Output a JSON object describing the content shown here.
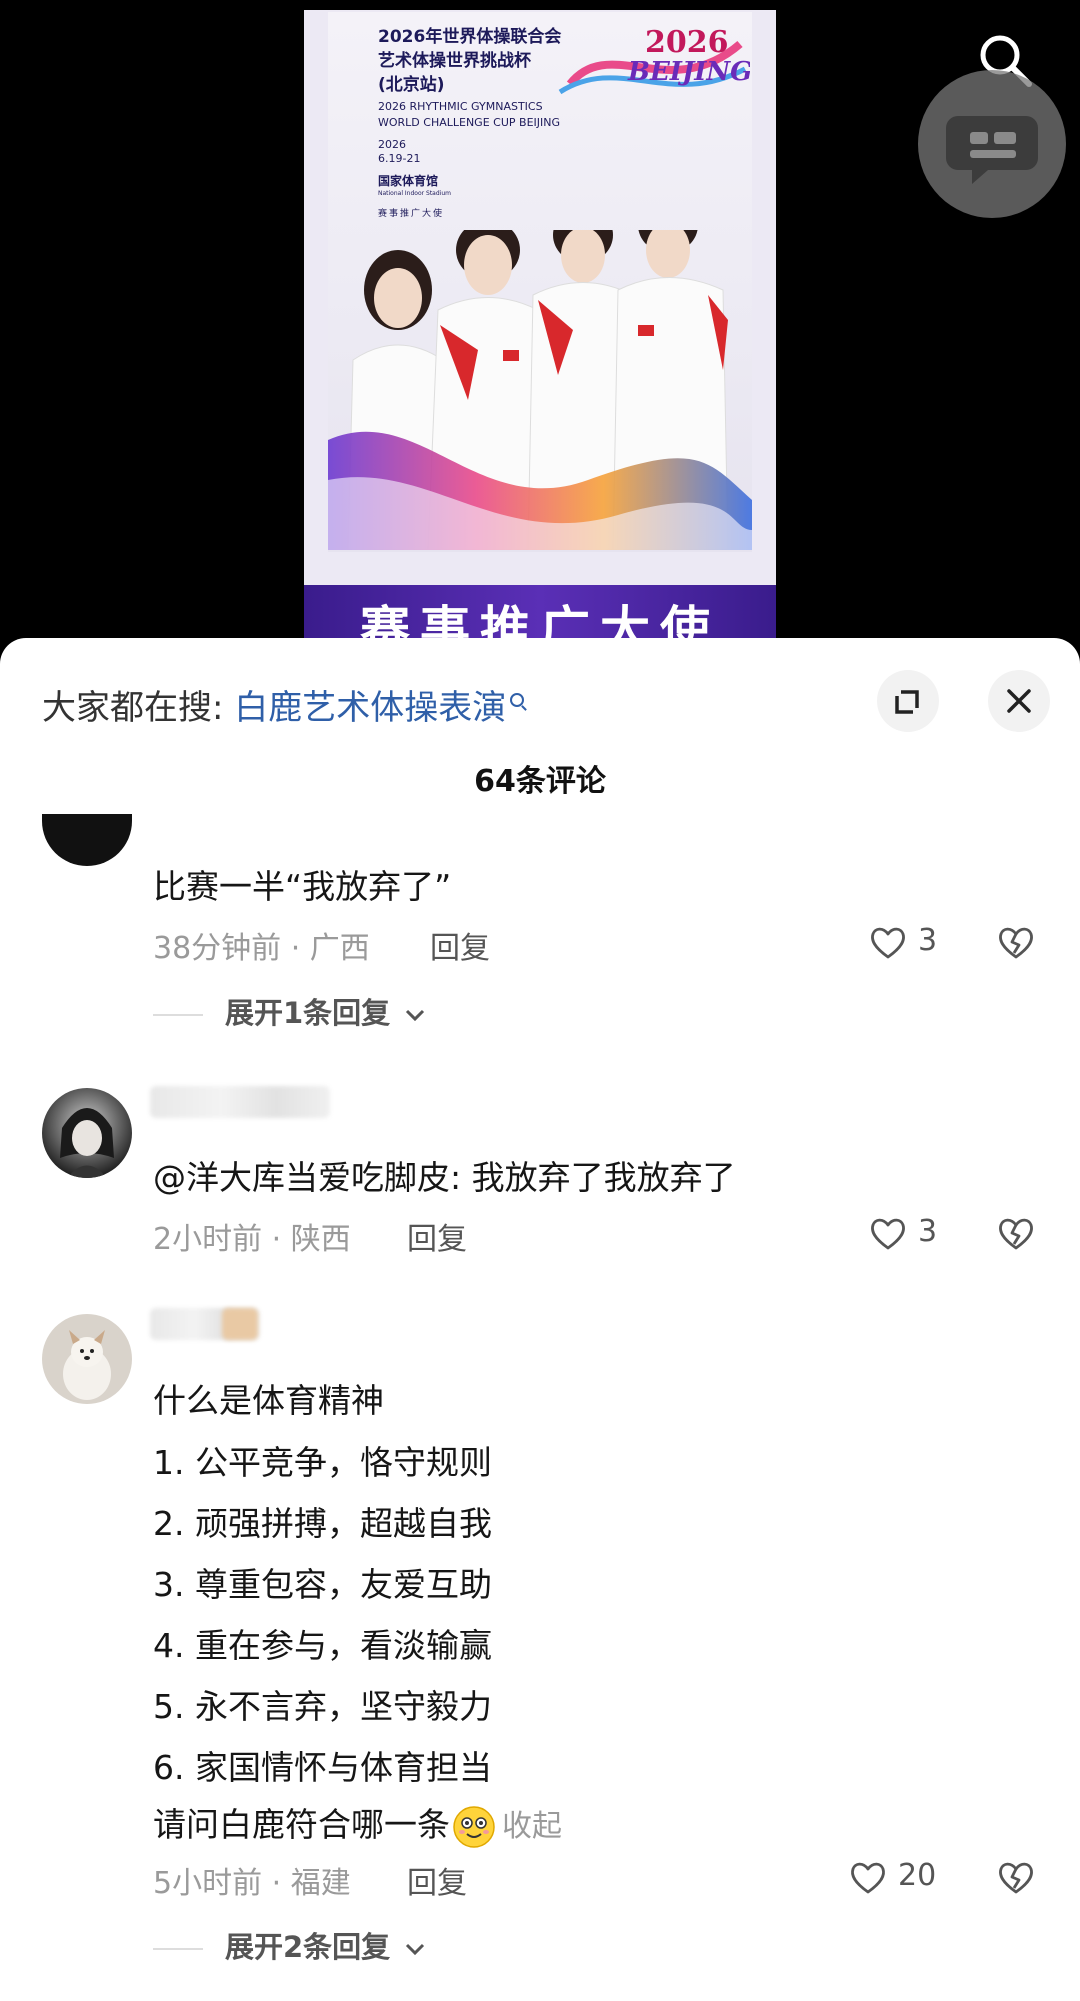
{
  "poster": {
    "title_line1": "2026年世界体操联合会",
    "title_line2": "艺术体操世界挑战杯",
    "title_line3": "(北京站)",
    "subtitle_en_1": "2026 RHYTHMIC GYMNASTICS",
    "subtitle_en_2": "WORLD CHALLENGE CUP BEIJING",
    "year": "2026",
    "dates": "6.19-21",
    "venue": "国家体育馆",
    "venue_en": "National Indoor Stadium",
    "ambassador_label": "赛事推广大使",
    "logo_year": "2026",
    "logo_city": "BEIJING",
    "banner_text": "赛事推广大使"
  },
  "sheet": {
    "search_prefix": "大家都在搜:",
    "search_keyword": "白鹿艺术体操表演",
    "comment_count": "64条评论"
  },
  "comments": [
    {
      "text": "比赛一半“我放弃了”",
      "time_location": "38分钟前 · 广西",
      "reply_label": "回复",
      "likes": "3",
      "expand_replies": "展开1条回复"
    },
    {
      "text": "@洋大库当爱吃脚皮: 我放弃了我放弃了",
      "time_location": "2小时前 · 陕西",
      "reply_label": "回复",
      "likes": "3"
    },
    {
      "lines": [
        "什么是体育精神",
        "1. 公平竞争，恪守规则",
        "2. 顽强拼搏，超越自我",
        "3. 尊重包容，友爱互助",
        "4. 重在参与，看淡输赢",
        "5. 永不言弃，坚守毅力",
        "6. 家国情怀与体育担当",
        "请问白鹿符合哪一条"
      ],
      "collapse_label": "收起",
      "time_location": "5小时前 · 福建",
      "reply_label": "回复",
      "likes": "20",
      "expand_replies": "展开2条回复"
    }
  ],
  "colors": {
    "keyword": "#2f5fa8",
    "meta": "#9a9a9a",
    "banner": "#4a25a0"
  },
  "icons": [
    "search-icon",
    "chat-bubble-icon",
    "expand-icon",
    "close-icon",
    "heart-icon",
    "broken-heart-icon",
    "chevron-down-icon",
    "smile-emoji-icon"
  ]
}
